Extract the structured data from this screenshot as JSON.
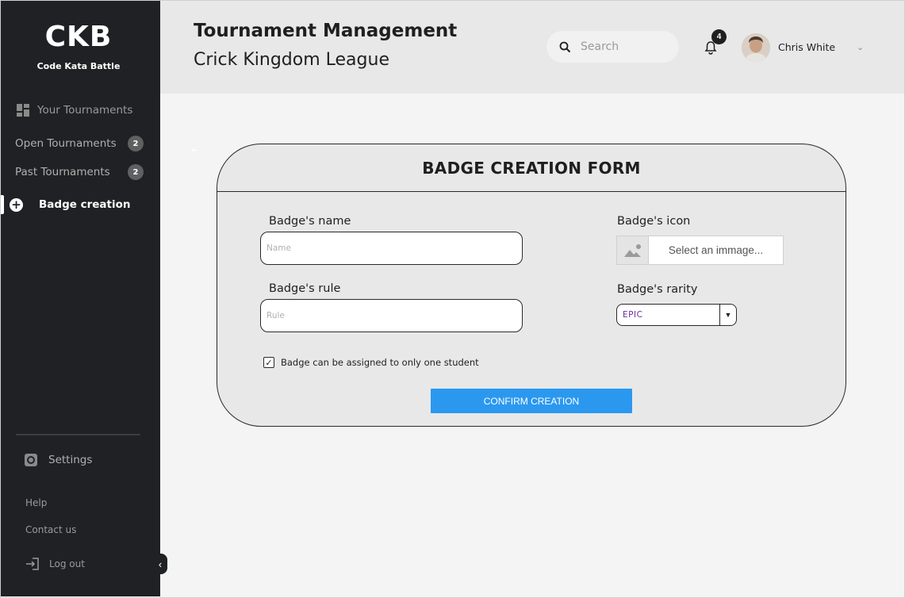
{
  "app": {
    "logo": "CKB",
    "logo_subtitle": "Code Kata Battle"
  },
  "sidebar": {
    "section_label": "Your Tournaments",
    "items": [
      {
        "label": "Open Tournaments",
        "count": "2"
      },
      {
        "label": "Past Tournaments",
        "count": "2"
      }
    ],
    "active_item": "Badge creation",
    "settings_label": "Settings",
    "help_label": "Help",
    "contact_label": "Contact us",
    "logout_label": "Log out"
  },
  "header": {
    "title": "Tournament Management",
    "subtitle": "Crick Kingdom League",
    "search_placeholder": "Search",
    "notifications_count": "4",
    "user_name": "Chris White"
  },
  "form": {
    "title": "BADGE CREATION FORM",
    "name_label": "Badge's name",
    "name_placeholder": "Name",
    "rule_label": "Badge's rule",
    "rule_placeholder": "Rule",
    "icon_label": "Badge's icon",
    "icon_placeholder": "Select an immage...",
    "rarity_label": "Badge's rarity",
    "rarity_value": "EPIC",
    "checkbox_label": "Badge can be assigned to only one student",
    "checkbox_checked": true,
    "confirm_label": "CONFIRM CREATION"
  },
  "colors": {
    "sidebar_bg": "#202124",
    "accent_button": "#2b98f0",
    "rarity_text": "#6a2f9a"
  }
}
